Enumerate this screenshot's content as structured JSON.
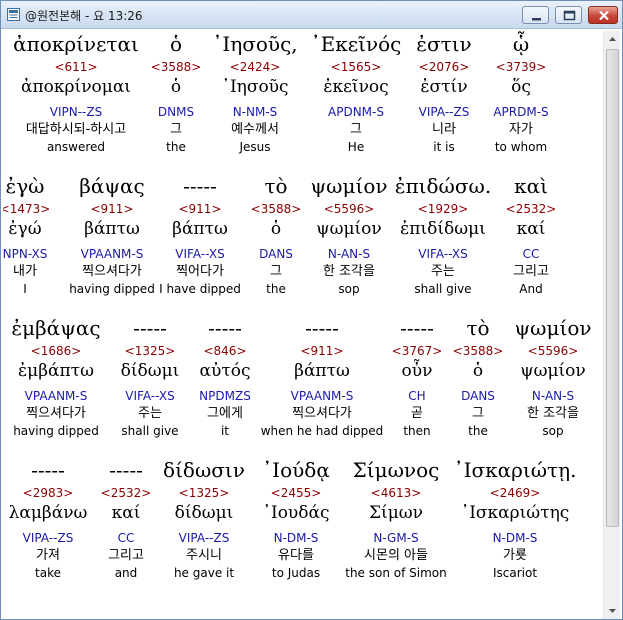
{
  "window": {
    "title": "@원전본해 - 요 13:26",
    "minimize_label": "minimize",
    "maximize_label": "maximize",
    "close_label": "close"
  },
  "rows": [
    {
      "words": [
        {
          "greek": "ἀποκρίνεται",
          "strong": "<611>",
          "lemma": "ἀποκρίνομαι",
          "parse": "VIPN--ZS",
          "korean": "대답하시되-하시고",
          "english": "answered"
        },
        {
          "greek": "ὁ",
          "strong": "<3588>",
          "lemma": "ὁ",
          "parse": "DNMS",
          "korean": "그",
          "english": "the"
        },
        {
          "greek": "᾽Ιησοῦς,",
          "strong": "<2424>",
          "lemma": "᾽Ιησοῦς",
          "parse": "N-NM-S",
          "korean": "예수께서",
          "english": "Jesus"
        },
        {
          "greek": "᾽Εκεῖνός",
          "strong": "<1565>",
          "lemma": "ἐκεῖνος",
          "parse": "APDNM-S",
          "korean": "그",
          "english": "He"
        },
        {
          "greek": "ἐστιν",
          "strong": "<2076>",
          "lemma": "ἐστίν",
          "parse": "VIPA--ZS",
          "korean": "니라",
          "english": "it is"
        },
        {
          "greek": "ᾧ",
          "strong": "<3739>",
          "lemma": "ὅς",
          "parse": "APRDM-S",
          "korean": "자가",
          "english": "to whom"
        }
      ]
    },
    {
      "words": [
        {
          "greek": "ἐγὼ",
          "strong": "<1473>",
          "lemma": "ἐγώ",
          "parse": "NPN-XS",
          "korean": "내가",
          "english": "I"
        },
        {
          "greek": "βάψας",
          "strong": "<911>",
          "lemma": "βάπτω",
          "parse": "VPAANM-S",
          "korean": "찍으셔다가",
          "english": "having dipped"
        },
        {
          "greek": "-----",
          "strong": "<911>",
          "lemma": "βάπτω",
          "parse": "VIFA--XS",
          "korean": "찍어다가",
          "english": "I have dipped"
        },
        {
          "greek": "τὸ",
          "strong": "<3588>",
          "lemma": "ὁ",
          "parse": "DANS",
          "korean": "그",
          "english": "the"
        },
        {
          "greek": "ψωμίον",
          "strong": "<5596>",
          "lemma": "ψωμίον",
          "parse": "N-AN-S",
          "korean": "한 조각을",
          "english": "sop"
        },
        {
          "greek": "ἐπιδώσω.",
          "strong": "<1929>",
          "lemma": "ἐπιδίδωμι",
          "parse": "VIFA--XS",
          "korean": "주는",
          "english": "shall give"
        },
        {
          "greek": "καὶ",
          "strong": "<2532>",
          "lemma": "καί",
          "parse": "CC",
          "korean": "그리고",
          "english": "And"
        }
      ]
    },
    {
      "words": [
        {
          "greek": "ἐμβάψας",
          "strong": "<1686>",
          "lemma": "ἐμβάπτω",
          "parse": "VPAANM-S",
          "korean": "찍으셔다가",
          "english": "having dipped"
        },
        {
          "greek": "-----",
          "strong": "<1325>",
          "lemma": "δίδωμι",
          "parse": "VIFA--XS",
          "korean": "주는",
          "english": "shall give"
        },
        {
          "greek": "-----",
          "strong": "<846>",
          "lemma": "αὐτός",
          "parse": "NPDMZS",
          "korean": "그에게",
          "english": "it"
        },
        {
          "greek": "-----",
          "strong": "<911>",
          "lemma": "βάπτω",
          "parse": "VPAANM-S",
          "korean": "찍으셔다가",
          "english": "when he had dipped"
        },
        {
          "greek": "-----",
          "strong": "<3767>",
          "lemma": "οὖν",
          "parse": "CH",
          "korean": "곧",
          "english": "then"
        },
        {
          "greek": "τὸ",
          "strong": "<3588>",
          "lemma": "ὁ",
          "parse": "DANS",
          "korean": "그",
          "english": "the"
        },
        {
          "greek": "ψωμίον",
          "strong": "<5596>",
          "lemma": "ψωμίον",
          "parse": "N-AN-S",
          "korean": "한 조각을",
          "english": "sop"
        }
      ]
    },
    {
      "words": [
        {
          "greek": "-----",
          "strong": "<2983>",
          "lemma": "λαμβάνω",
          "parse": "VIPA--ZS",
          "korean": "가져",
          "english": "take"
        },
        {
          "greek": "-----",
          "strong": "<2532>",
          "lemma": "καί",
          "parse": "CC",
          "korean": "그리고",
          "english": "and"
        },
        {
          "greek": "δίδωσιν",
          "strong": "<1325>",
          "lemma": "δίδωμι",
          "parse": "VIPA--ZS",
          "korean": "주시니",
          "english": "he gave it"
        },
        {
          "greek": "᾽Ιούδᾳ",
          "strong": "<2455>",
          "lemma": "᾽Ιουδάς",
          "parse": "N-DM-S",
          "korean": "유다를",
          "english": "to Judas"
        },
        {
          "greek": "Σίμωνος",
          "strong": "<4613>",
          "lemma": "Σίμων",
          "parse": "N-GM-S",
          "korean": "시몬의 아들",
          "english": "the son of Simon"
        },
        {
          "greek": "᾽Ισκαριώτῃ.",
          "strong": "<2469>",
          "lemma": "᾽Ισκαριώτης",
          "parse": "N-DM-S",
          "korean": "가룟",
          "english": "Iscariot"
        }
      ]
    }
  ],
  "colors": {
    "strong_number": "#8b0000",
    "parse_code": "#1a1aa8",
    "text": "#000000"
  }
}
